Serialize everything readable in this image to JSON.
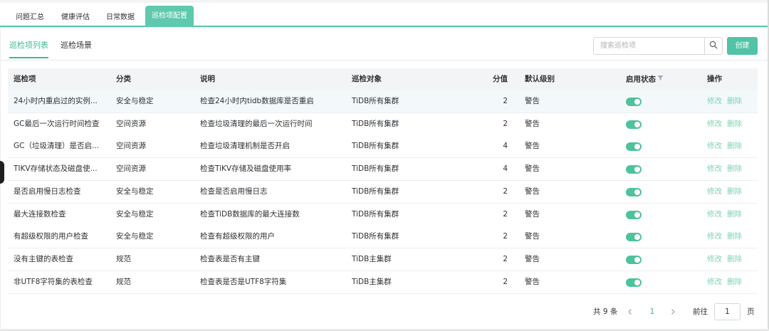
{
  "top_tabs": [
    {
      "label": "问题汇总"
    },
    {
      "label": "健康评估"
    },
    {
      "label": "日常数据"
    },
    {
      "label": "巡检项配置",
      "active": true
    }
  ],
  "sub_tabs": [
    {
      "label": "巡检项列表",
      "active": true
    },
    {
      "label": "巡检场景"
    }
  ],
  "search": {
    "placeholder": "搜索巡检项",
    "icon": "search-icon"
  },
  "create_button": {
    "label": "创建"
  },
  "table": {
    "headers": {
      "name": "巡检项",
      "category": "分类",
      "description": "说明",
      "target": "巡检对象",
      "score": "分值",
      "level": "默认级别",
      "status": "启用状态",
      "ops": "操作"
    },
    "rows": [
      {
        "name": "24小时内重启过的实例...",
        "category": "安全与稳定",
        "description": "检查24小时内tidb数据库是否重启",
        "target": "TiDB所有集群",
        "score": "2",
        "level": "警告",
        "enabled": true,
        "edit": "修改",
        "delete": "删除"
      },
      {
        "name": "GC最后一次运行时间检查",
        "category": "空间资源",
        "description": "检查垃圾清理的最后一次运行时间",
        "target": "TiDB所有集群",
        "score": "2",
        "level": "警告",
        "enabled": true,
        "edit": "修改",
        "delete": "删除"
      },
      {
        "name": "GC（垃圾清理）是否启...",
        "category": "空间资源",
        "description": "检查垃圾清理机制是否开启",
        "target": "TiDB所有集群",
        "score": "4",
        "level": "警告",
        "enabled": true,
        "edit": "修改",
        "delete": "删除"
      },
      {
        "name": "TIKV存储状态及磁盘使...",
        "category": "空间资源",
        "description": "检查TiKV存储及磁盘使用率",
        "target": "TiDB所有集群",
        "score": "4",
        "level": "警告",
        "enabled": true,
        "edit": "修改",
        "delete": "删除"
      },
      {
        "name": "是否启用慢日志检查",
        "category": "安全与稳定",
        "description": "检查是否启用慢日志",
        "target": "TiDB所有集群",
        "score": "2",
        "level": "警告",
        "enabled": true,
        "edit": "修改",
        "delete": "删除"
      },
      {
        "name": "最大连接数检查",
        "category": "安全与稳定",
        "description": "检查TiDB数据库的最大连接数",
        "target": "TiDB所有集群",
        "score": "2",
        "level": "警告",
        "enabled": true,
        "edit": "修改",
        "delete": "删除"
      },
      {
        "name": "有超级权限的用户检查",
        "category": "安全与稳定",
        "description": "检查有超级权限的用户",
        "target": "TiDB所有集群",
        "score": "2",
        "level": "警告",
        "enabled": true,
        "edit": "修改",
        "delete": "删除"
      },
      {
        "name": "没有主键的表检查",
        "category": "规范",
        "description": "检查表是否有主键",
        "target": "TiDB主集群",
        "score": "2",
        "level": "警告",
        "enabled": true,
        "edit": "修改",
        "delete": "删除"
      },
      {
        "name": "非UTF8字符集的表检查",
        "category": "规范",
        "description": "检查表是否是UTF8字符集",
        "target": "TiDB主集群",
        "score": "2",
        "level": "警告",
        "enabled": true,
        "edit": "修改",
        "delete": "删除"
      }
    ]
  },
  "pagination": {
    "total": "共 9 条",
    "current_page": "1",
    "goto_label": "前往",
    "goto_value": "1",
    "page_suffix": "页"
  },
  "colors": {
    "accent": "#52c3a6",
    "link": "#7fd2b6",
    "toggle_on": "#4ec29c"
  }
}
